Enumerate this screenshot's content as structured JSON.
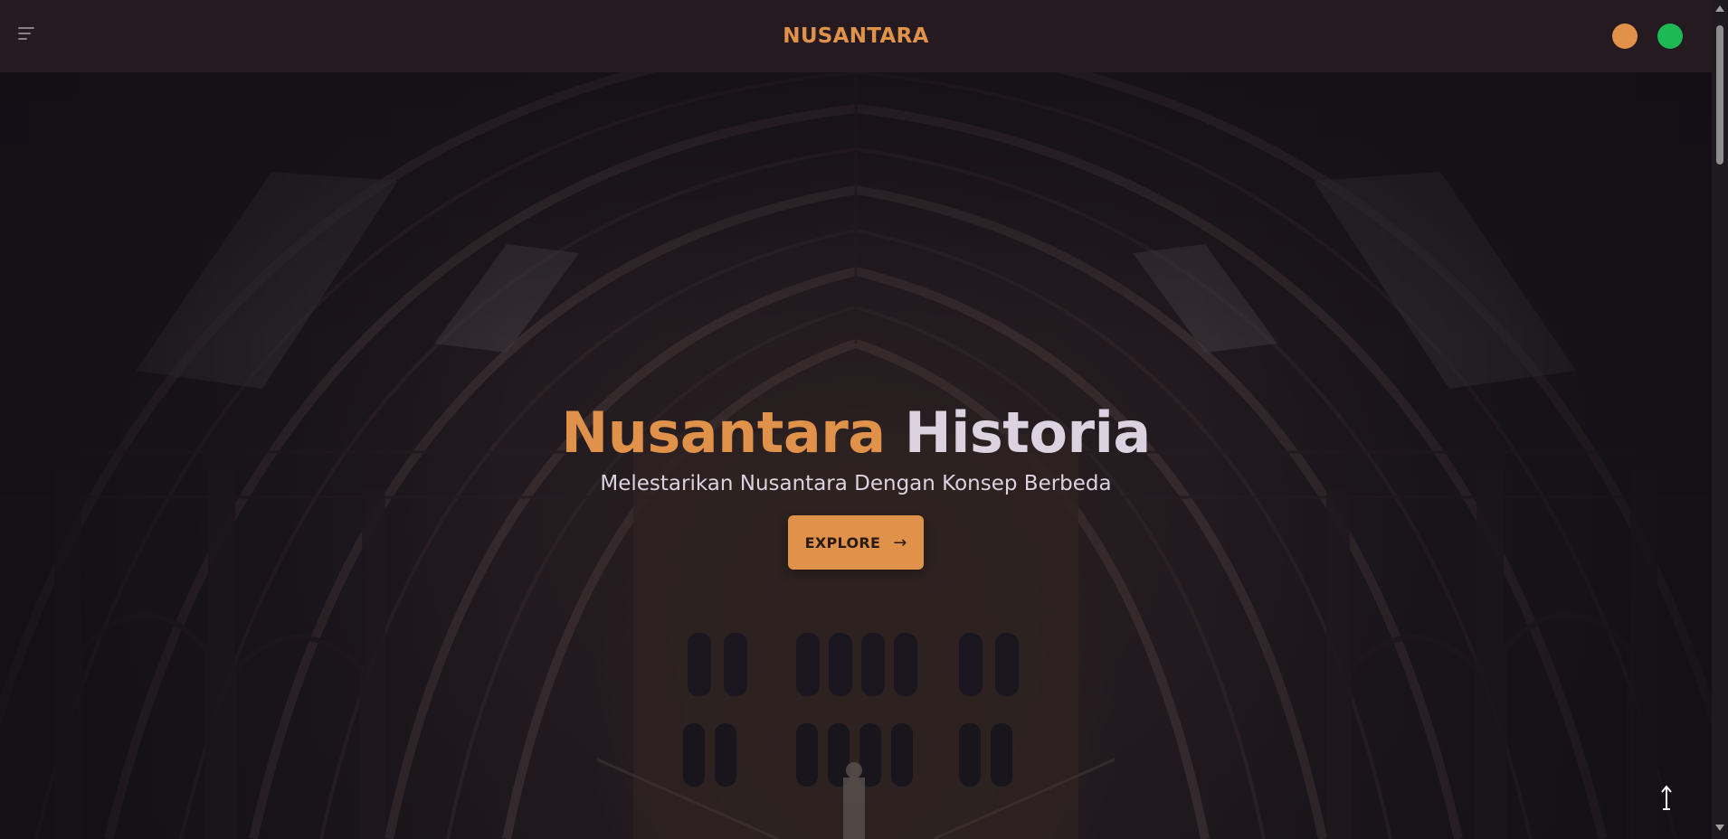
{
  "navbar": {
    "brand": "NUSANTARA",
    "menu_icon": "menu-icon",
    "dots": [
      {
        "color": "#e0914a"
      },
      {
        "color": "#1db954"
      }
    ]
  },
  "hero": {
    "title_part1": "Nusantara",
    "title_part2": "Historia",
    "subtitle": "Melestarikan Nusantara Dengan Konsep Berbeda",
    "cta_label": "EXPLORE",
    "cta_icon": "arrow-right-icon",
    "scroll_top_icon": "arrow-up-icon"
  },
  "colors": {
    "accent": "#e0914a",
    "navbar_bg": "#241a1f",
    "text_light": "#ddd2e0",
    "status_green": "#1db954"
  }
}
